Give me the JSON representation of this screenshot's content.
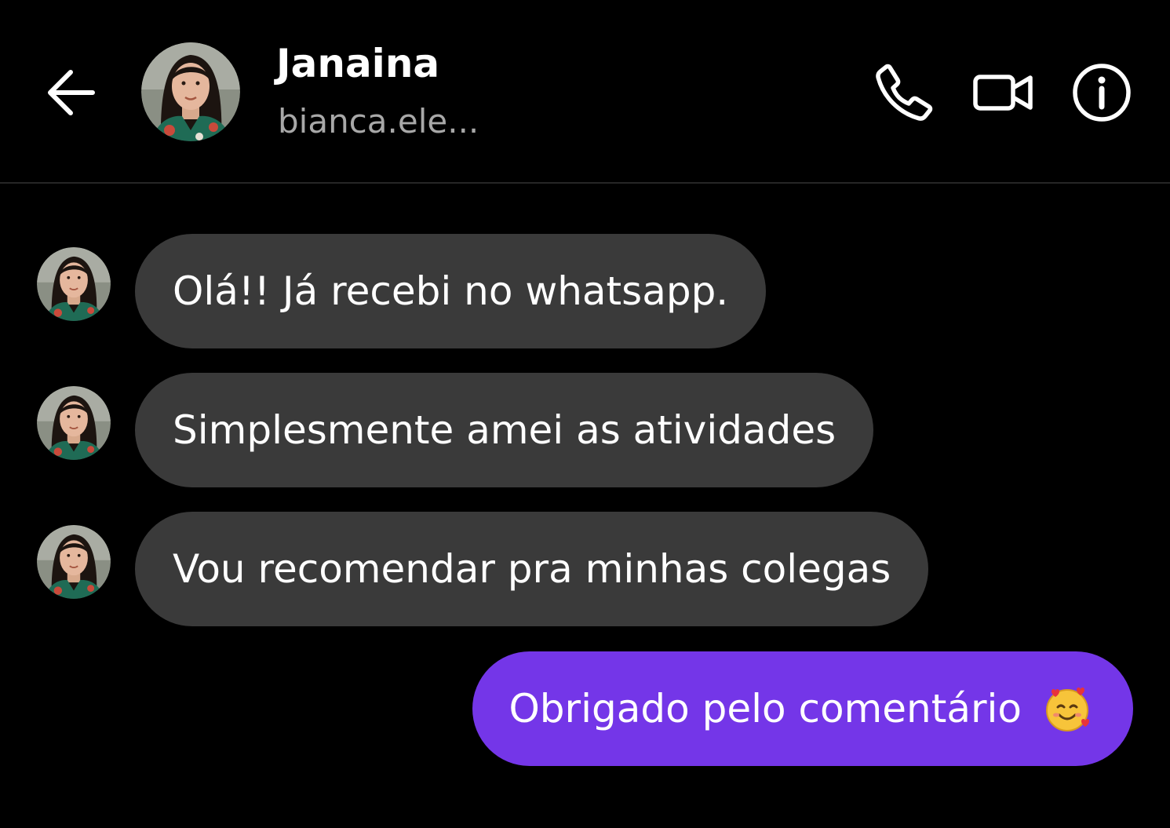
{
  "header": {
    "back_icon": "arrow-left-icon",
    "contact_name": "Janaina",
    "contact_username": "bianca.ele...",
    "actions": [
      {
        "name": "voice-call",
        "icon": "phone-icon"
      },
      {
        "name": "video-call",
        "icon": "video-camera-icon"
      },
      {
        "name": "info",
        "icon": "info-icon"
      }
    ]
  },
  "messages": [
    {
      "direction": "incoming",
      "text": "Olá!! Já recebi no whatsapp."
    },
    {
      "direction": "incoming",
      "text": "Simplesmente amei as atividades"
    },
    {
      "direction": "incoming",
      "text": "Vou recomendar pra minhas colegas"
    },
    {
      "direction": "outgoing",
      "text": "Obrigado pelo comentário",
      "emoji": "smiling-face-with-hearts"
    }
  ],
  "colors": {
    "background": "#000000",
    "incoming_bubble": "#3a3a3a",
    "outgoing_bubble": "#7436e8",
    "secondary_text": "#a8a8a8",
    "divider": "#262626"
  }
}
